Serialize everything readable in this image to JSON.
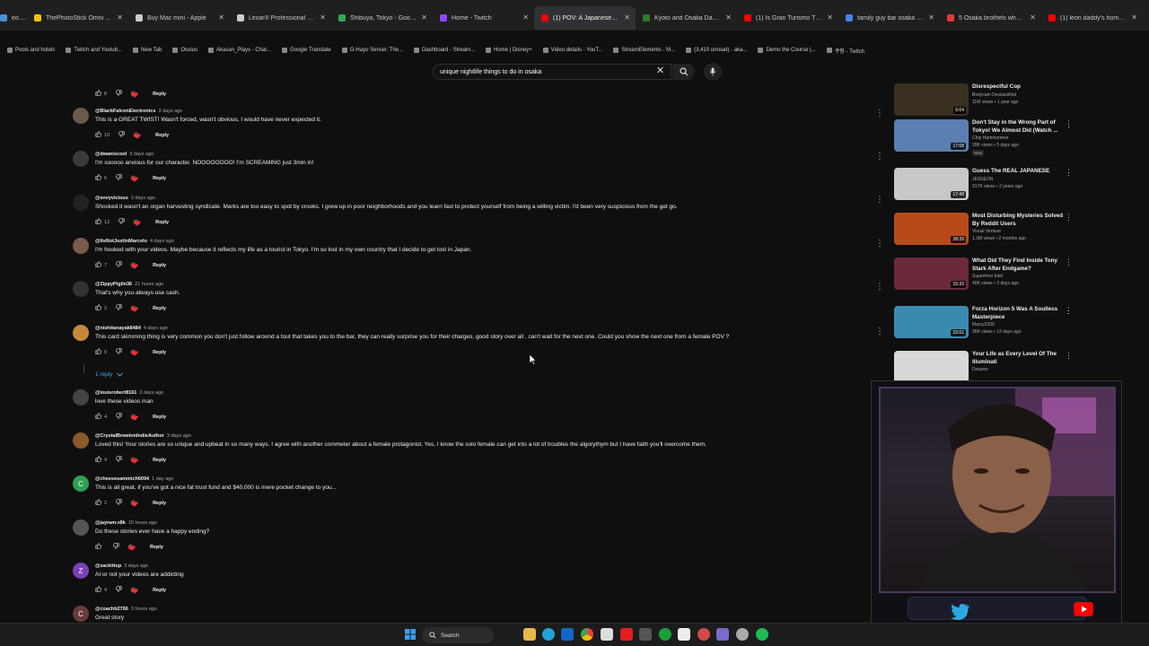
{
  "browser": {
    "tabs": [
      {
        "label": "eo.co.jp",
        "color": "#4a90d9",
        "active": false
      },
      {
        "label": "ThePhotoStick Omni 32GB, Pho",
        "color": "#f4c20d",
        "active": false
      },
      {
        "label": "Buy Mac mini - Apple",
        "color": "#cccccc",
        "active": false
      },
      {
        "label": "Lexar® Professional Go Port",
        "color": "#cccccc",
        "active": false
      },
      {
        "label": "Shibuya, Tokyo - Google Map",
        "color": "#34a853",
        "active": false
      },
      {
        "label": "Home - Twitch",
        "color": "#9146ff",
        "active": false
      },
      {
        "label": "(1) POV: A Japanese Girl Offe",
        "color": "#ff0000",
        "active": true
      },
      {
        "label": "Kyoto and Osaka Day Trip | K",
        "color": "#2d7a2d",
        "active": false
      },
      {
        "label": "(1) Is Gran Turismo The Best",
        "color": "#ff0000",
        "active": false
      },
      {
        "label": "family guy bar osaka - Googl",
        "color": "#4285f4",
        "active": false
      },
      {
        "label": "5 Osaka brothels where you c",
        "color": "#e53935",
        "active": false
      },
      {
        "label": "(1) leon daddy's home - YouT",
        "color": "#ff0000",
        "active": false
      }
    ],
    "bookmarks": [
      "Pools and hotels",
      "Twitch and Youtub...",
      "New Tab",
      "Oculus",
      "Akasan_Plays - Chat...",
      "Google Translate",
      "O-Hayo Sensei: The...",
      "Dashboard - Stream...",
      "Home | Disney+",
      "Video details - YouT...",
      "StreamElements - M...",
      "(3,410 unread) - aka...",
      "Demo the Course |...",
      "쿠팡 - Twitch"
    ]
  },
  "search": {
    "query": "unique nightlife things to do in osaka",
    "clear_icon": "close-icon",
    "search_icon": "search-icon",
    "mic_icon": "mic-icon"
  },
  "comments": [
    {
      "author": "",
      "time": "",
      "text": "",
      "likes": "8",
      "reply": "Reply",
      "avatar_color": "#555",
      "avatar_letter": "",
      "actions_only": true
    },
    {
      "author": "@BlackFalconElectronics",
      "time": "3 days ago",
      "text": "This is a GREAT TWIST! Wasn't forced, wasn't obvious, I would have never expected it.",
      "likes": "10",
      "reply": "Reply",
      "avatar_color": "#6b5a4a",
      "avatar_letter": ""
    },
    {
      "author": "@dwaniscool",
      "time": "3 days ago",
      "text": "I'm sooooo anxious for our character. NOOOOOOOO! I'm SCREAMING just 3min in!",
      "likes": "6",
      "reply": "Reply",
      "avatar_color": "#3a3a3a",
      "avatar_letter": ""
    },
    {
      "author": "@envyvicious",
      "time": "3 days ago",
      "text": "Shocked it wasn't an organ harvesting syndicate. Marks are too easy to spot by crooks. I grew up in poor neighborhoods and you learn fast to protect yourself from being a willing victim. I'd been very suspicious from the get go.",
      "likes": "13",
      "reply": "Reply",
      "avatar_color": "#222222",
      "avatar_letter": ""
    },
    {
      "author": "@ItsNotJustinMarcelo",
      "time": "4 days ago",
      "text": "I'm hooked with your videos. Maybe because it reflects my life as a tourist in Tokyo. I'm so lost in my own country that I decide to get lost in Japan.",
      "likes": "7",
      "reply": "Reply",
      "avatar_color": "#7a5a4a",
      "avatar_letter": ""
    },
    {
      "author": "@ZippyPiglin36",
      "time": "21 hours ago",
      "text": "That's why you always use cash.",
      "likes": "2",
      "reply": "Reply",
      "avatar_color": "#333333",
      "avatar_letter": ""
    },
    {
      "author": "@nishitanayak8484",
      "time": "4 days ago",
      "text": "This card skimming thing is very common you don't just follow around a tout that takes you to the bar, they can really surprise you for their charges, good story over all , can't wait for the next one. Could you show the next one from a female POV ?",
      "likes": "9",
      "reply": "Reply",
      "avatar_color": "#c48a3a",
      "avatar_letter": ""
    },
    {
      "author": "@louisrobert8161",
      "time": "3 days ago",
      "text": "love these videos man",
      "likes": "4",
      "reply": "Reply",
      "avatar_color": "#444444",
      "avatar_letter": ""
    },
    {
      "author": "@CrystalBrewtonIndieAuthor",
      "time": "3 days ago",
      "text": "Loved this!  Your stories are so unique and upbeat in so many ways.  I agree with another commeter about a female protagonist.  Yes, I know the solo female can get into a lot of troubles the algorythym  but I have faith you'll overcome them.",
      "likes": "4",
      "reply": "Reply",
      "avatar_color": "#8a5a2a",
      "avatar_letter": ""
    },
    {
      "author": "@cheesesammich6094",
      "time": "1 day ago",
      "text": "This is all great, if you've got a nice fat trust fund and $40,000 is mere pocket change to you...",
      "likes": "2",
      "reply": "Reply",
      "avatar_color": "#2e9e4e",
      "avatar_letter": "C"
    },
    {
      "author": "@jayram-z8k",
      "time": "15 hours ago",
      "text": "Do these stories ever have a happy ending?",
      "likes": "",
      "reply": "Reply",
      "avatar_color": "#555555",
      "avatar_letter": ""
    },
    {
      "author": "@zackittup",
      "time": "3 days ago",
      "text": "AI or not your videos are addicting",
      "likes": "4",
      "reply": "Reply",
      "avatar_color": "#7b3fb8",
      "avatar_letter": "Z"
    },
    {
      "author": "@coachb2766",
      "time": "3 hours ago",
      "text": "Great story",
      "likes": "",
      "reply": "",
      "avatar_color": "#6a3a3a",
      "avatar_letter": "C"
    }
  ],
  "replies_toggle": {
    "label": "1 reply"
  },
  "sidebar": [
    {
      "title": "Disrespectful Cop",
      "channel": "Bodycam Declassified",
      "meta": "11M views • 1 year ago",
      "duration": "6:04",
      "thumb": "#3a3020",
      "new": ""
    },
    {
      "title": "Don't Stay in the Wrong Part of Tokyo! We Almost Did (Watch ...",
      "channel": "Chip Hammontree",
      "meta": "39K views • 5 days ago",
      "duration": "17:08",
      "thumb": "#5a7fb0",
      "new": "New"
    },
    {
      "title": "Guess The REAL JAPANESE",
      "channel": "JESSEON",
      "meta": "917K views • 2 years ago",
      "duration": "17:48",
      "thumb": "#c8c8c8",
      "new": ""
    },
    {
      "title": "Most Disturbing Mysteries Solved By Reddit Users",
      "channel": "Visual Venture",
      "meta": "1.3M views • 2 months ago",
      "duration": "28:39",
      "thumb": "#b84a1a",
      "new": ""
    },
    {
      "title": "What Did They Find Inside Tony Stark After Endgame?",
      "channel": "Superhero Intel",
      "meta": "40K views • 2 days ago",
      "duration": "15:33",
      "thumb": "#6a2a3a",
      "new": ""
    },
    {
      "title": "Forza Horizon 5 Was A Soulless Masterpiece",
      "channel": "Marcy2200",
      "meta": "36K views • 12 days ago",
      "duration": "22:01",
      "thumb": "#3a8ab0",
      "new": ""
    },
    {
      "title": "Your Life as Every Level Of The Illuminati",
      "channel": "Dreamo",
      "meta": "",
      "duration": "",
      "thumb": "#d8d8d8",
      "new": ""
    }
  ],
  "taskbar": {
    "search_label": "Search"
  },
  "colors": {
    "accent": "#3ea6ff",
    "youtube_red": "#ff0000",
    "twitch": "#9146ff"
  }
}
